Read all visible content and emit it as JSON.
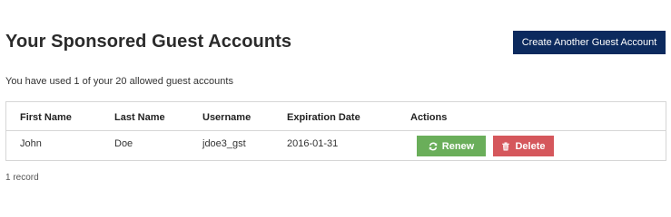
{
  "header": {
    "title": "Your Sponsored Guest Accounts",
    "create_button_label": "Create Another Guest Account"
  },
  "usage_text": "You have used 1 of your 20 allowed guest accounts",
  "table": {
    "columns": [
      "First Name",
      "Last Name",
      "Username",
      "Expiration Date",
      "Actions"
    ],
    "rows": [
      {
        "first_name": "John",
        "last_name": "Doe",
        "username": "jdoe3_gst",
        "expiration_date": "2016-01-31",
        "actions": {
          "renew_label": "Renew",
          "renew_icon": "refresh-icon",
          "delete_label": "Delete",
          "delete_icon": "trash-icon"
        }
      }
    ]
  },
  "footer": {
    "record_count": "1 record"
  },
  "colors": {
    "primary": "#0c2a5e",
    "renew": "#6aae5a",
    "delete": "#d5575c"
  }
}
